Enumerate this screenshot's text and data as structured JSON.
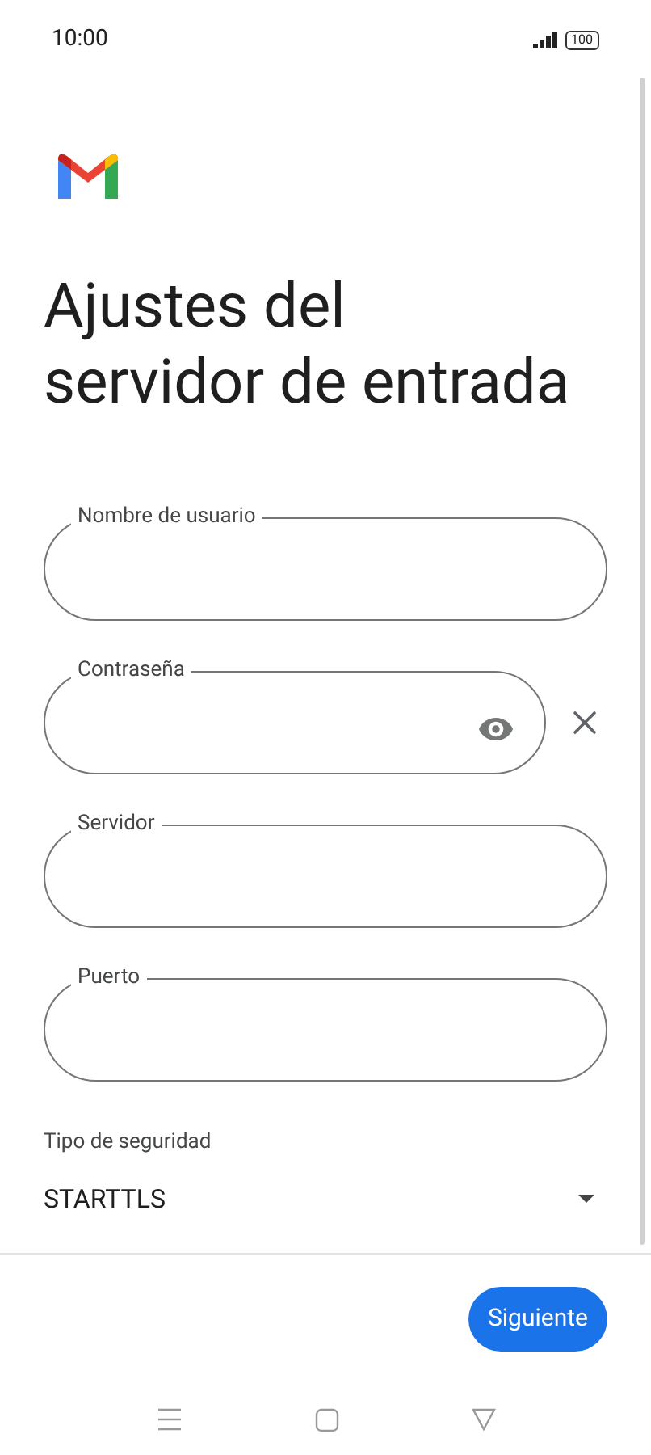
{
  "status_bar": {
    "time": "10:00",
    "battery": "100"
  },
  "title_lines": [
    "Ajustes del",
    "servidor de entrada"
  ],
  "fields": [
    {
      "kind": "plain",
      "label": "Nombre de usuario"
    },
    {
      "kind": "password",
      "label": "Contraseña"
    },
    {
      "kind": "plain",
      "label": "Servidor"
    },
    {
      "kind": "plain",
      "label": "Puerto"
    }
  ],
  "security": {
    "label": "Tipo de seguridad",
    "value": "STARTTLS"
  },
  "next_button": "Siguiente"
}
